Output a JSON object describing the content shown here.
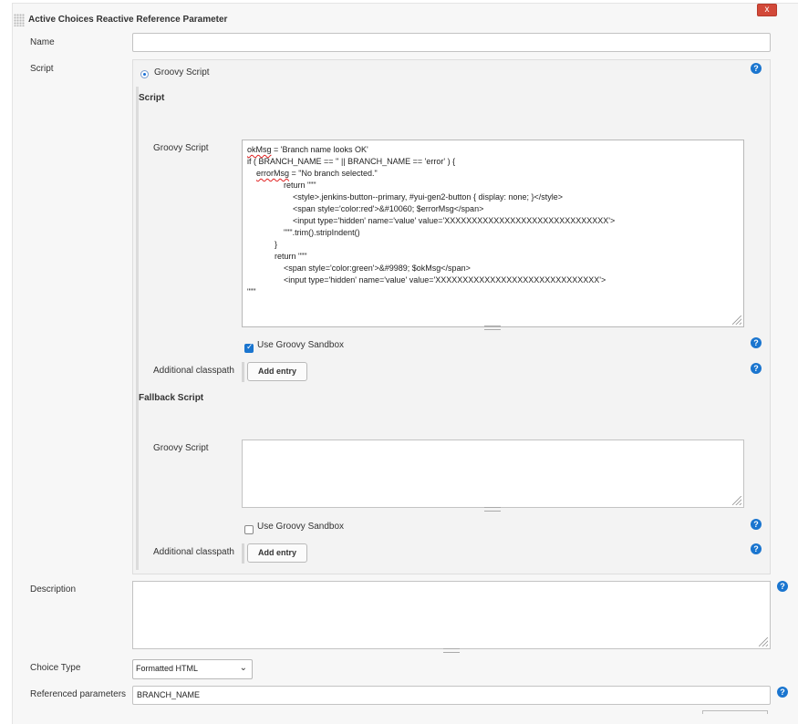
{
  "panel": {
    "title": "Active Choices Reactive Reference Parameter",
    "close_label": "x"
  },
  "name_field": {
    "label": "Name",
    "value": ""
  },
  "script": {
    "label": "Script",
    "radio_label": "Groovy Script",
    "section_title": "Script",
    "groovy_label": "Groovy Script",
    "code_lines": [
      "okMsg = 'Branch name looks OK'",
      "if ( BRANCH_NAME == '' || BRANCH_NAME == 'error' ) {",
      "    errorMsg = \"No branch selected.\"",
      "                return \"\"\"",
      "                    <style>.jenkins-button--primary, #yui-gen2-button { display: none; }</style>",
      "                    <span style='color:red'>&#10060; $errorMsg</span>",
      "                    <input type='hidden' name='value' value='XXXXXXXXXXXXXXXXXXXXXXXXXXXXXX'>",
      "                \"\"\".trim().stripIndent()",
      "            }",
      "            return \"\"\"",
      "                <span style='color:green'>&#9989; $okMsg</span>",
      "                <input type='hidden' name='value' value='XXXXXXXXXXXXXXXXXXXXXXXXXXXXXX'>",
      "\"\"\""
    ],
    "sandbox_label": "Use Groovy Sandbox",
    "sandbox_checked": true,
    "classpath_label": "Additional classpath",
    "add_entry": "Add entry"
  },
  "fallback": {
    "section_title": "Fallback Script",
    "groovy_label": "Groovy Script",
    "value": "",
    "sandbox_label": "Use Groovy Sandbox",
    "sandbox_checked": false,
    "classpath_label": "Additional classpath",
    "add_entry": "Add entry"
  },
  "description": {
    "label": "Description",
    "value": ""
  },
  "choice_type": {
    "label": "Choice Type",
    "selected": "Formatted HTML"
  },
  "referenced": {
    "label": "Referenced parameters",
    "value": "BRANCH_NAME"
  },
  "help_glyph": "?",
  "colors": {
    "accent": "#1a75cf",
    "close": "#d24939",
    "spellcheck": "#e02020"
  }
}
